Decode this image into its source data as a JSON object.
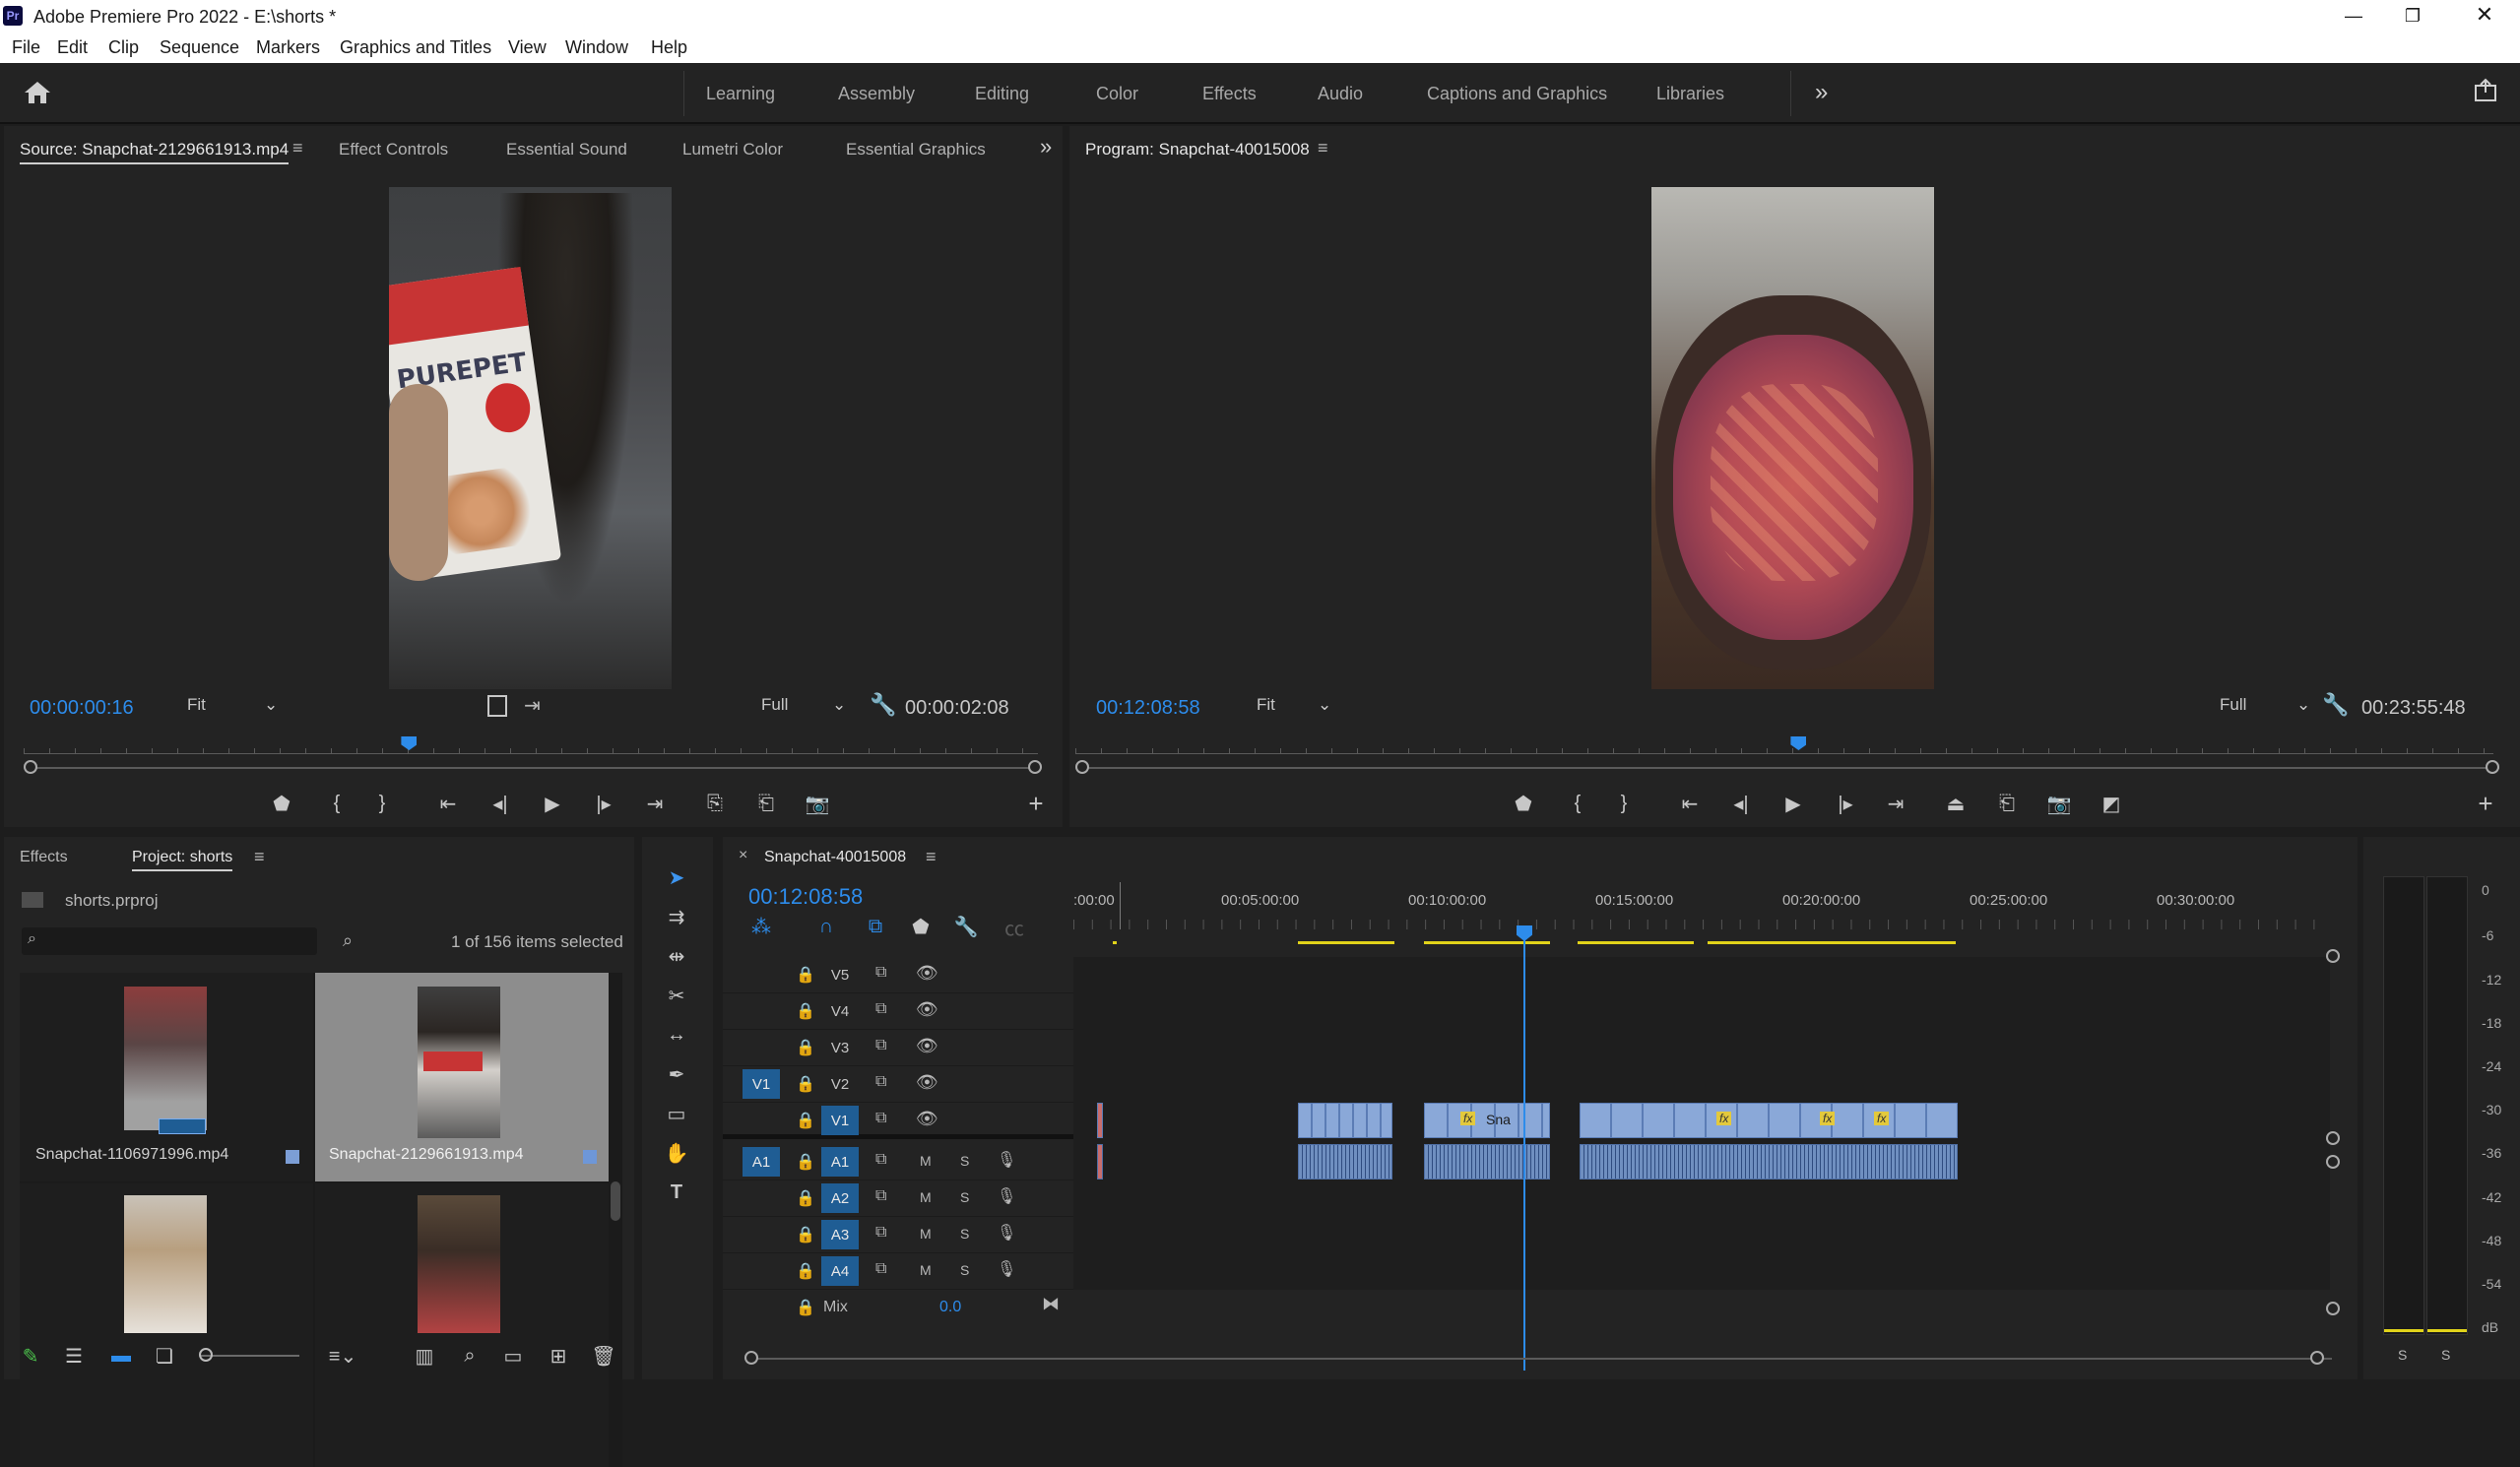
{
  "app": {
    "title": "Adobe Premiere Pro 2022 - E:\\shorts *",
    "logo": "Pr",
    "window_controls": [
      "minimize-icon",
      "maximize-icon",
      "close-icon"
    ]
  },
  "menu": [
    "File",
    "Edit",
    "Clip",
    "Sequence",
    "Markers",
    "Graphics and Titles",
    "View",
    "Window",
    "Help"
  ],
  "workspaces": {
    "items": [
      "Learning",
      "Assembly",
      "Editing",
      "Color",
      "Effects",
      "Audio",
      "Captions and Graphics",
      "Libraries"
    ],
    "overflow": "»"
  },
  "source_panel": {
    "tabs": [
      "Source: Snapchat-2129661913.mp4",
      "Effect Controls",
      "Essential Sound",
      "Lumetri Color",
      "Essential Graphics"
    ],
    "overflow": "»",
    "timecode": "00:00:00:16",
    "zoom": "Fit",
    "resolution": "Full",
    "duration": "00:00:02:08",
    "playhead_fraction": 0.38
  },
  "program_panel": {
    "title": "Program: Snapchat-40015008",
    "timecode": "00:12:08:58",
    "zoom": "Fit",
    "resolution": "Full",
    "duration": "00:23:55:48",
    "playhead_fraction": 0.51
  },
  "project_panel": {
    "tabs": [
      "Effects",
      "Project: shorts"
    ],
    "file": "shorts.prproj",
    "search_placeholder": "",
    "selection_info": "1 of 156 items selected",
    "items": [
      {
        "name": "Snapchat-1106971996.mp4",
        "selected": false
      },
      {
        "name": "Snapchat-2129661913.mp4",
        "selected": true
      },
      {
        "name": "",
        "selected": false
      },
      {
        "name": "",
        "selected": false
      }
    ]
  },
  "timeline": {
    "tab": "Snapchat-40015008",
    "timecode": "00:12:08:58",
    "ruler": [
      ":00:00",
      "00:05:00:00",
      "00:10:00:00",
      "00:15:00:00",
      "00:20:00:00",
      "00:25:00:00",
      "00:30:00:00"
    ],
    "video_tracks": [
      "V5",
      "V4",
      "V3",
      "V2",
      "V1"
    ],
    "audio_tracks": [
      "A1",
      "A2",
      "A3",
      "A4"
    ],
    "source_patch": {
      "video": "V1",
      "audio": "A1"
    },
    "mix_label": "Mix",
    "mix_value": "0.0",
    "clip_label": "Sna",
    "fx_badge": "fx",
    "track_buttons": {
      "mute": "M",
      "solo": "S"
    }
  },
  "meter": {
    "scale": [
      "0",
      "-6",
      "-12",
      "-18",
      "-24",
      "-30",
      "-36",
      "-42",
      "-48",
      "-54",
      "dB"
    ],
    "solo": [
      "S",
      "S"
    ]
  },
  "colors": {
    "accent": "#2d8ceb",
    "clip_video": "#8aa8d8",
    "clip_audio": "#6f8fc0",
    "work_area": "#e1d31a"
  }
}
